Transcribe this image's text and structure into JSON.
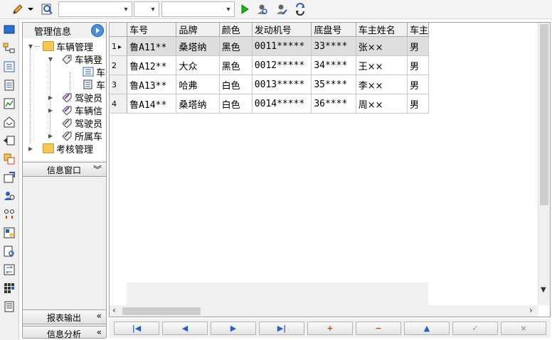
{
  "toolbar": {
    "combo1_value": "",
    "combo2_value": "",
    "combo3_value": "",
    "icons": [
      "pencil-icon",
      "dropdown-arrow-icon",
      "search-doc-icon",
      "run-icon",
      "user-search-icon",
      "user-edit-icon",
      "refresh-icon"
    ]
  },
  "leftbar": {
    "icons": [
      "screen-icon",
      "network-icon",
      "list-icon",
      "document-icon",
      "chart-icon",
      "inbox-icon",
      "export-icon",
      "forms-icon",
      "settings-icon",
      "search-people-icon",
      "link-icon",
      "record-icon",
      "document-search-icon",
      "transfer-icon",
      "grid-icon",
      "book-icon"
    ]
  },
  "nav": {
    "title": "管理信息",
    "tree": [
      {
        "label": "车辆管理",
        "level": 0,
        "expanded": true
      },
      {
        "label": "车辆登",
        "level": 1,
        "expanded": true
      },
      {
        "label": "车",
        "level": 2
      },
      {
        "label": "车",
        "level": 2
      },
      {
        "label": "驾驶员",
        "level": 1
      },
      {
        "label": "车辆信",
        "level": 1
      },
      {
        "label": "驾驶员",
        "level": 1
      },
      {
        "label": "所属车",
        "level": 1
      },
      {
        "label": "考核管理",
        "level": 0
      }
    ],
    "info_window": "信息窗口",
    "report_output": "报表输出",
    "info_analysis": "信息分析"
  },
  "grid": {
    "columns": [
      "车号",
      "品牌",
      "颜色",
      "发动机号",
      "底盘号",
      "车主姓名",
      "车主"
    ],
    "rows": [
      {
        "rn": "1",
        "cells": [
          "鲁A11**",
          "桑塔纳",
          "黑色",
          "0011*****",
          "33****",
          "张××",
          "男"
        ]
      },
      {
        "rn": "2",
        "cells": [
          "鲁A12**",
          "大众",
          "黑色",
          "0012*****",
          "34****",
          "王××",
          "男"
        ]
      },
      {
        "rn": "3",
        "cells": [
          "鲁A13**",
          "哈弗",
          "白色",
          "0013*****",
          "35****",
          "李××",
          "男"
        ]
      },
      {
        "rn": "4",
        "cells": [
          "鲁A14**",
          "桑塔纳",
          "白色",
          "0014*****",
          "36****",
          "周××",
          "男"
        ]
      }
    ],
    "current_row_marker": "▸"
  },
  "navigator": {
    "buttons": [
      {
        "name": "first-record-button",
        "glyph": "|◀",
        "color": "#2a5fbf"
      },
      {
        "name": "prior-record-button",
        "glyph": "◀",
        "color": "#2a5fbf"
      },
      {
        "name": "next-record-button",
        "glyph": "▶",
        "color": "#2a5fbf"
      },
      {
        "name": "last-record-button",
        "glyph": "▶|",
        "color": "#2a5fbf"
      },
      {
        "name": "insert-record-button",
        "glyph": "+",
        "color": "#d23b16"
      },
      {
        "name": "delete-record-button",
        "glyph": "−",
        "color": "#d23b16"
      },
      {
        "name": "edit-record-button",
        "glyph": "▲",
        "color": "#2a5fbf"
      },
      {
        "name": "post-record-button",
        "glyph": "✓",
        "color": "#9a9a9a"
      },
      {
        "name": "cancel-record-button",
        "glyph": "×",
        "color": "#9a9a9a"
      }
    ]
  }
}
